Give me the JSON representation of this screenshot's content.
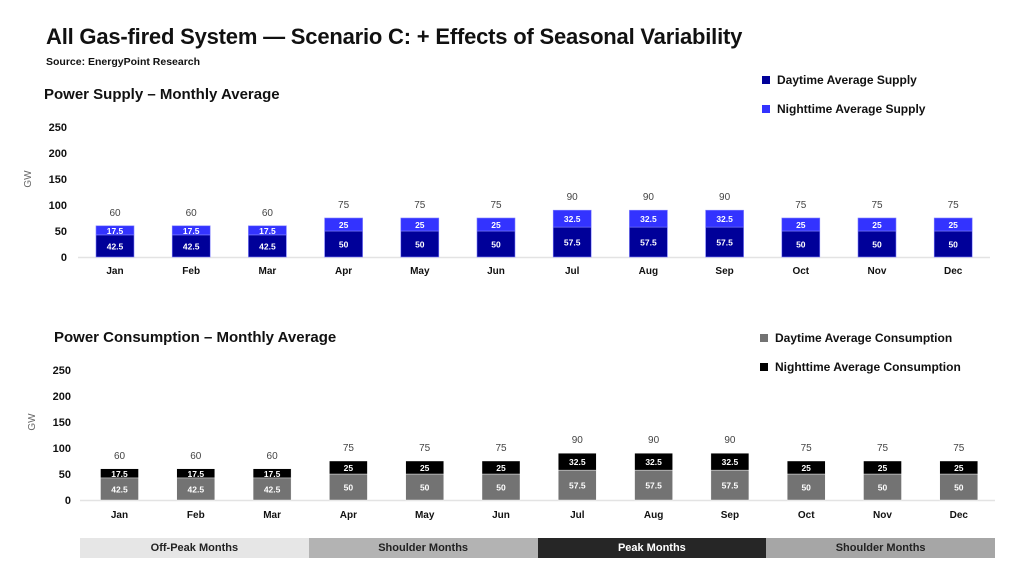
{
  "title": "All Gas-fired System — Scenario C: + Effects of Seasonal Variability",
  "source": "Source: EnergyPoint Research",
  "chart_data": [
    {
      "type": "bar",
      "stacked": true,
      "title": "Power Supply – Monthly Average",
      "ylabel": "GW",
      "xlabel": "",
      "ylim": [
        0,
        250
      ],
      "yticks": [
        0,
        50,
        100,
        150,
        200,
        250
      ],
      "categories": [
        "Jan",
        "Feb",
        "Mar",
        "Apr",
        "May",
        "Jun",
        "Jul",
        "Aug",
        "Sep",
        "Oct",
        "Nov",
        "Dec"
      ],
      "series": [
        {
          "name": "Daytime Average Supply",
          "color": "#000099",
          "label_color": "#ffffff",
          "values": [
            42.5,
            42.5,
            42.5,
            50,
            50,
            50,
            57.5,
            57.5,
            57.5,
            50,
            50,
            50
          ]
        },
        {
          "name": "Nighttime Average Supply",
          "color": "#3333ff",
          "label_color": "#ffffff",
          "values": [
            17.5,
            17.5,
            17.5,
            25,
            25,
            25,
            32.5,
            32.5,
            32.5,
            25,
            25,
            25
          ]
        }
      ],
      "totals": [
        60,
        60,
        60,
        75,
        75,
        75,
        90,
        90,
        90,
        75,
        75,
        75
      ],
      "grid": false,
      "legend": "top-right"
    },
    {
      "type": "bar",
      "stacked": true,
      "title": "Power Consumption – Monthly Average",
      "ylabel": "GW",
      "xlabel": "",
      "ylim": [
        0,
        250
      ],
      "yticks": [
        0,
        50,
        100,
        150,
        200,
        250
      ],
      "categories": [
        "Jan",
        "Feb",
        "Mar",
        "Apr",
        "May",
        "Jun",
        "Jul",
        "Aug",
        "Sep",
        "Oct",
        "Nov",
        "Dec"
      ],
      "series": [
        {
          "name": "Daytime Average Consumption",
          "color": "#737373",
          "label_color": "#ffffff",
          "values": [
            42.5,
            42.5,
            42.5,
            50,
            50,
            50,
            57.5,
            57.5,
            57.5,
            50,
            50,
            50
          ]
        },
        {
          "name": "Nighttime Average Consumption",
          "color": "#000000",
          "label_color": "#ffffff",
          "values": [
            17.5,
            17.5,
            17.5,
            25,
            25,
            25,
            32.5,
            32.5,
            32.5,
            25,
            25,
            25
          ]
        }
      ],
      "totals": [
        60,
        60,
        60,
        75,
        75,
        75,
        90,
        90,
        90,
        75,
        75,
        75
      ],
      "grid": false,
      "legend": "top-right"
    }
  ],
  "season_bands": [
    {
      "label": "Off-Peak Months",
      "bg": "#e6e6e6",
      "fg": "#222222"
    },
    {
      "label": "Shoulder Months",
      "bg": "#b3b3b3",
      "fg": "#222222"
    },
    {
      "label": "Peak Months",
      "bg": "#262626",
      "fg": "#ffffff"
    },
    {
      "label": "Shoulder Months",
      "bg": "#a6a6a6",
      "fg": "#222222"
    }
  ]
}
